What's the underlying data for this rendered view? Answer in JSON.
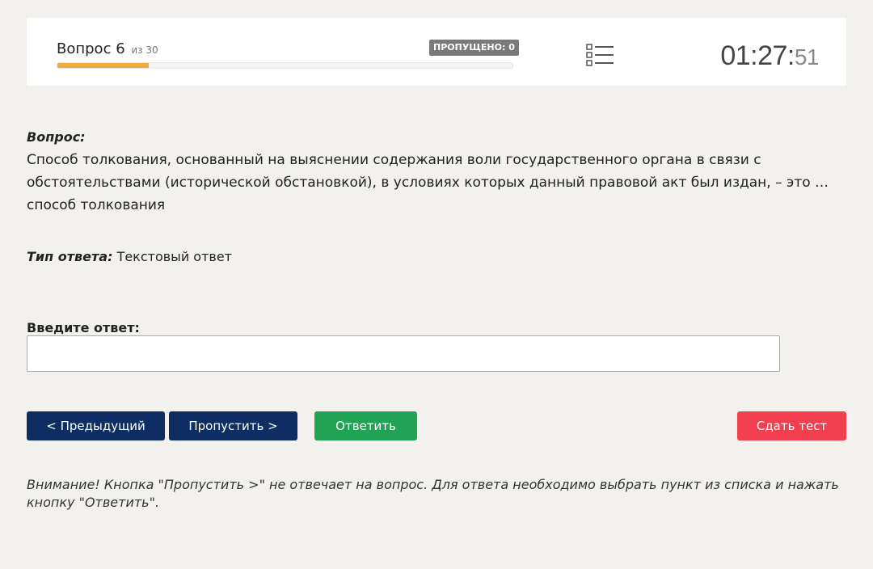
{
  "header": {
    "question_word": "Вопрос",
    "question_number": "6",
    "of_total": "из 30",
    "skipped_badge": "ПРОПУЩЕНО: 0",
    "progress_fraction": 0.2,
    "list_icon": "list-icon",
    "timer_main": "01:27:",
    "timer_seconds": "51"
  },
  "question": {
    "caption": "Вопрос:",
    "text": "Способ толкования, основанный на выяснении содержания воли государственного органа в связи с обстоятельствами (исторической обстановкой), в условиях которых данный правовой акт был издан, – это … способ толкования"
  },
  "answer_type": {
    "caption": "Тип ответа:",
    "value": "Текстовый ответ"
  },
  "answer_input": {
    "label": "Введите ответ:",
    "value": "",
    "placeholder": ""
  },
  "buttons": {
    "prev": "< Предыдущий",
    "skip": "Пропустить >",
    "answer": "Ответить",
    "submit": "Сдать тест"
  },
  "colors": {
    "nav_button": "#0e2d63",
    "answer_button": "#22a254",
    "submit_button": "#f0404f",
    "progress": "#f0ad3e",
    "badge": "#7a7a7a"
  },
  "notice": "Внимание! Кнопка \"Пропустить >\" не отвечает на вопрос. Для ответа необходимо выбрать пункт из списка и нажать кнопку \"Ответить\"."
}
